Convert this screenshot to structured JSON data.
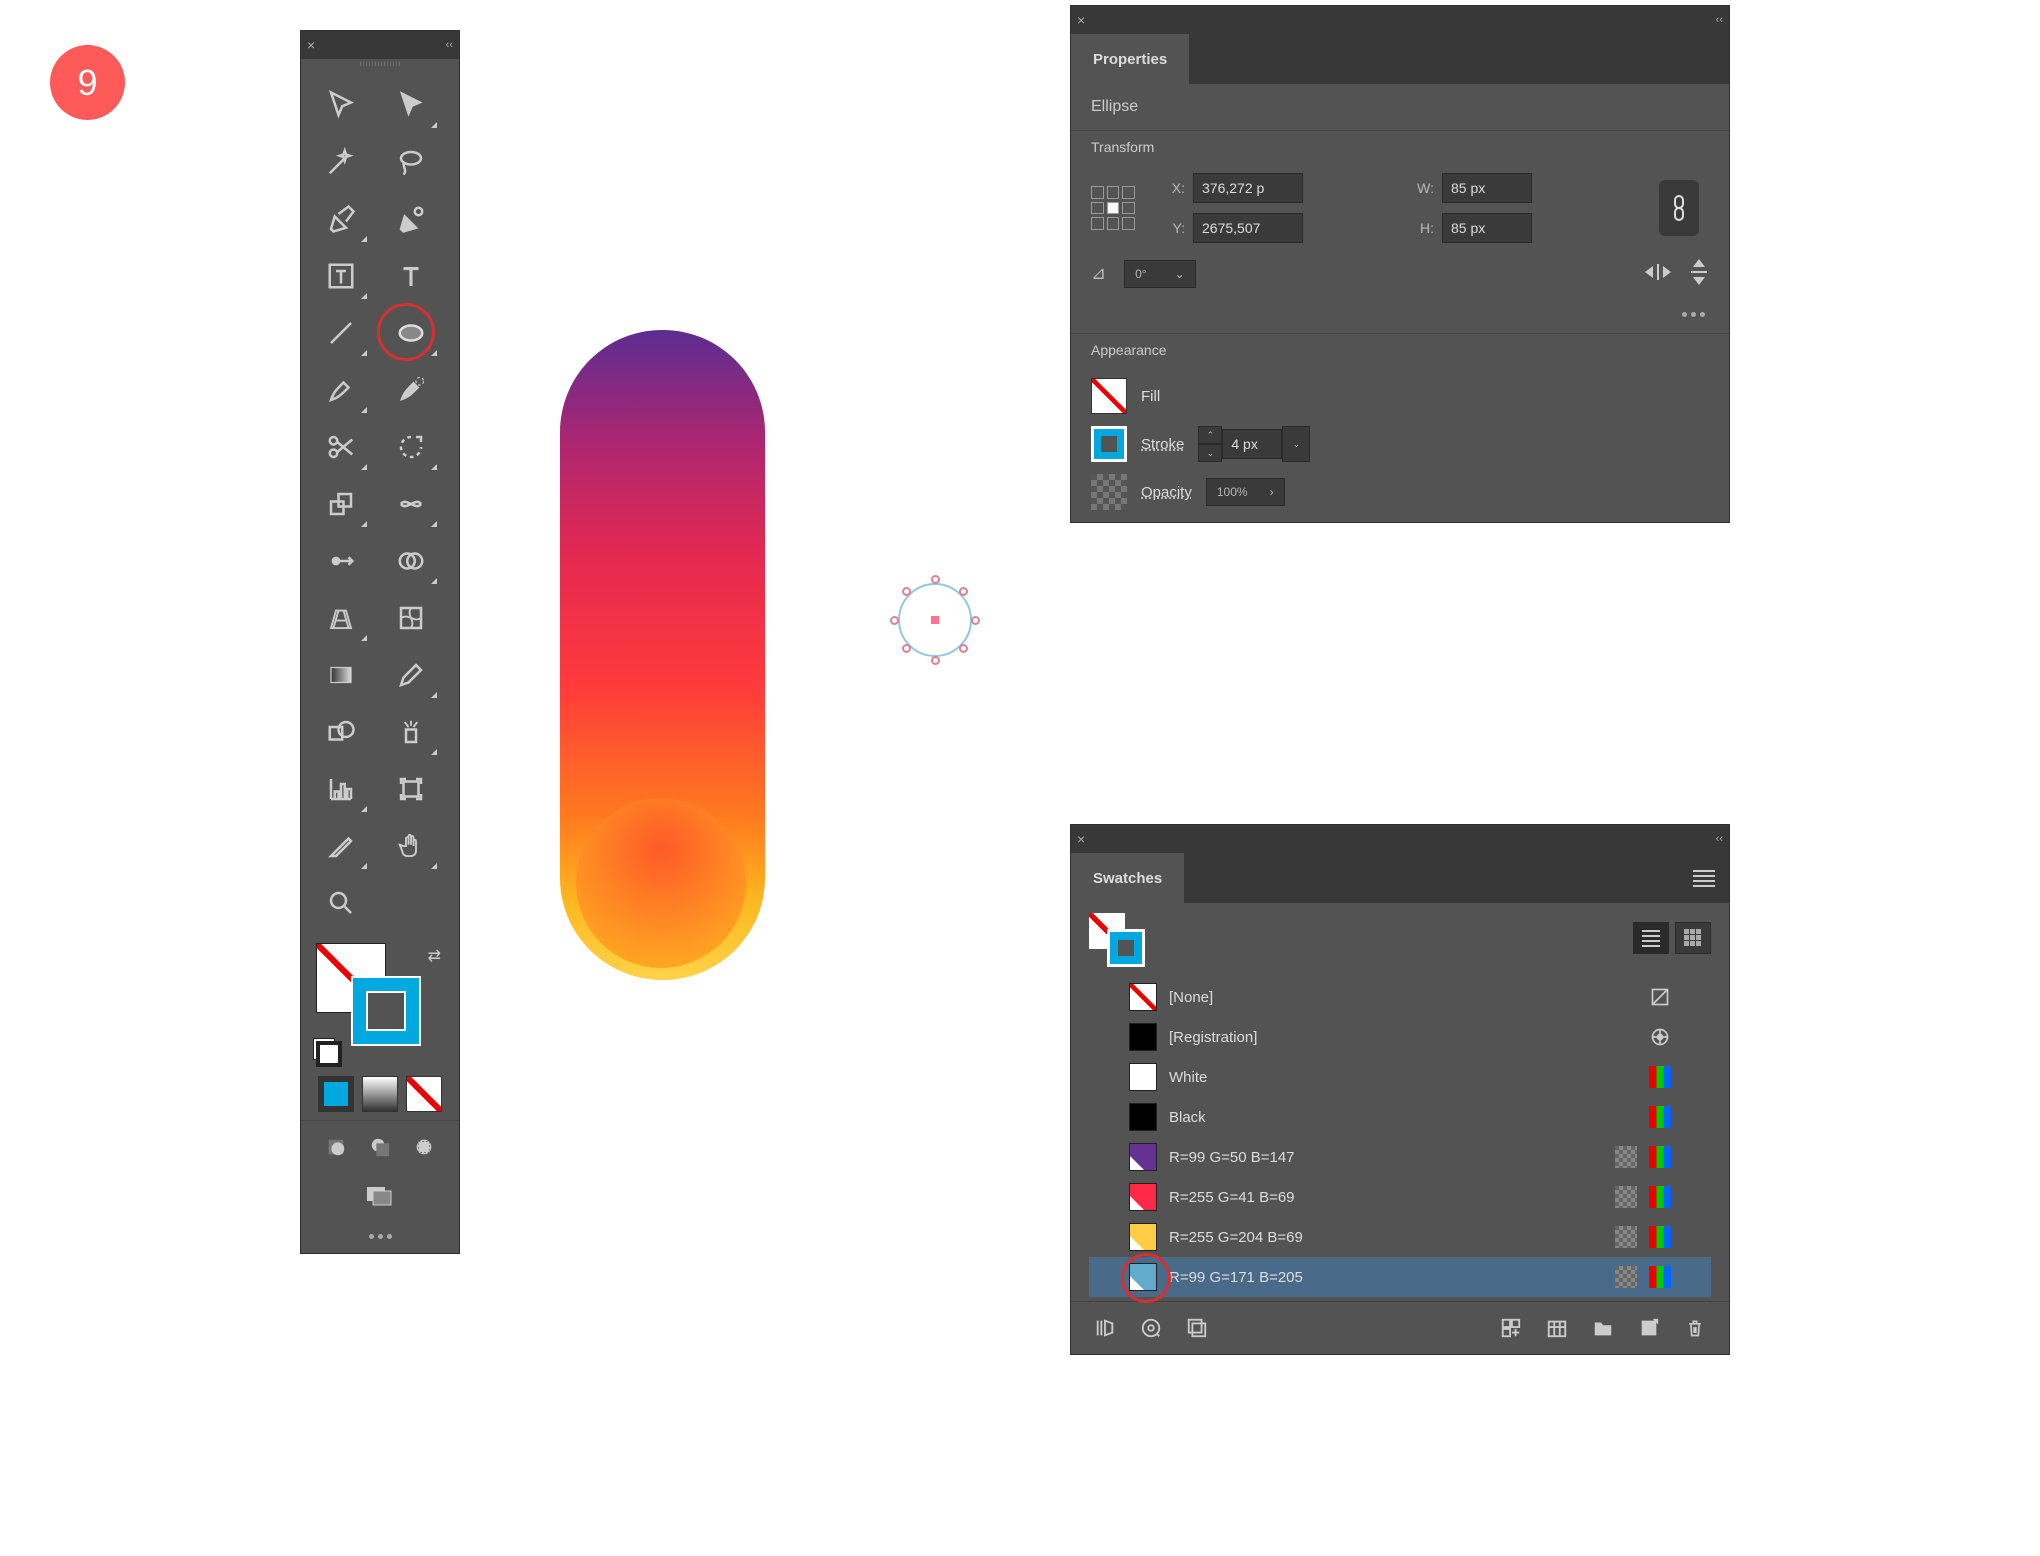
{
  "step_number": "9",
  "toolbar": {
    "highlighted_tool": "ellipse-tool",
    "color_modes": [
      "solid",
      "gradient",
      "none"
    ],
    "draw_modes": [
      "normal",
      "behind",
      "inside"
    ]
  },
  "properties": {
    "panel_title": "Properties",
    "shape_type": "Ellipse",
    "transform_label": "Transform",
    "x_label": "X:",
    "x_value": "376,272 p",
    "y_label": "Y:",
    "y_value": "2675,507",
    "w_label": "W:",
    "w_value": "85 px",
    "h_label": "H:",
    "h_value": "85 px",
    "rotation": "0°",
    "appearance_label": "Appearance",
    "fill_label": "Fill",
    "stroke_label": "Stroke",
    "stroke_width": "4 px",
    "opacity_label": "Opacity",
    "opacity_value": "100%"
  },
  "swatches": {
    "panel_title": "Swatches",
    "items": [
      {
        "name": "[None]",
        "color": "none"
      },
      {
        "name": "[Registration]",
        "color": "#000"
      },
      {
        "name": "White",
        "color": "#fff"
      },
      {
        "name": "Black",
        "color": "#000"
      },
      {
        "name": "R=99 G=50 B=147",
        "color": "#633293"
      },
      {
        "name": "R=255 G=41 B=69",
        "color": "#ff2945"
      },
      {
        "name": "R=255 G=204 B=69",
        "color": "#ffcc45"
      },
      {
        "name": "R=99 G=171 B=205",
        "color": "#63abcd"
      }
    ],
    "selected_index": 7
  }
}
